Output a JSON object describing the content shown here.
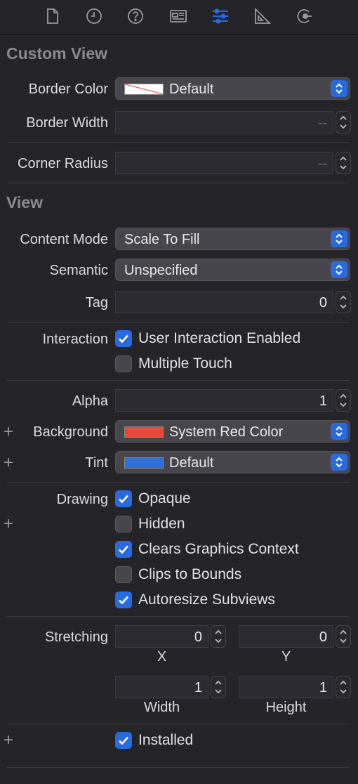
{
  "toolbar": {
    "icons": [
      "file-inspector-icon",
      "history-inspector-icon",
      "help-inspector-icon",
      "identity-inspector-icon",
      "attributes-inspector-icon",
      "size-inspector-icon",
      "connections-inspector-icon"
    ],
    "active": "attributes-inspector-icon",
    "accent": "#2a6ae0"
  },
  "custom_view": {
    "title": "Custom View",
    "border_color": {
      "label": "Border Color",
      "value": "Default"
    },
    "border_width": {
      "label": "Border Width",
      "value": "--"
    },
    "corner_radius": {
      "label": "Corner Radius",
      "value": "--"
    }
  },
  "view": {
    "title": "View",
    "content_mode": {
      "label": "Content Mode",
      "value": "Scale To Fill"
    },
    "semantic": {
      "label": "Semantic",
      "value": "Unspecified"
    },
    "tag": {
      "label": "Tag",
      "value": "0"
    },
    "interaction": {
      "label": "Interaction",
      "user_interaction": {
        "label": "User Interaction Enabled",
        "checked": true
      },
      "multiple_touch": {
        "label": "Multiple Touch",
        "checked": false
      }
    },
    "alpha": {
      "label": "Alpha",
      "value": "1"
    },
    "background": {
      "label": "Background",
      "value": "System Red Color",
      "color": "#e74a3c"
    },
    "tint": {
      "label": "Tint",
      "value": "Default",
      "color": "#2f6fd6"
    },
    "drawing": {
      "label": "Drawing",
      "opaque": {
        "label": "Opaque",
        "checked": true
      },
      "hidden": {
        "label": "Hidden",
        "checked": false
      },
      "clears": {
        "label": "Clears Graphics Context",
        "checked": true
      },
      "clips": {
        "label": "Clips to Bounds",
        "checked": false
      },
      "autoresize": {
        "label": "Autoresize Subviews",
        "checked": true
      }
    },
    "stretching": {
      "label": "Stretching",
      "x": {
        "value": "0",
        "caption": "X"
      },
      "y": {
        "value": "0",
        "caption": "Y"
      },
      "width": {
        "value": "1",
        "caption": "Width"
      },
      "height": {
        "value": "1",
        "caption": "Height"
      }
    },
    "installed": {
      "label": "Installed",
      "checked": true
    }
  },
  "plus_symbol": "+"
}
